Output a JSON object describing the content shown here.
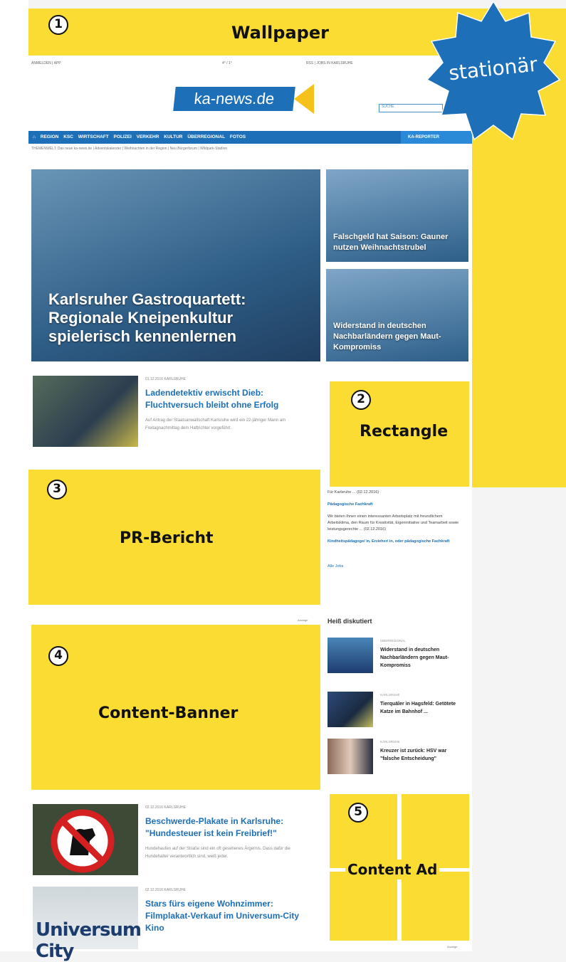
{
  "zones": {
    "wallpaper": {
      "number": "1",
      "label": "Wallpaper"
    },
    "rectangle": {
      "number": "2",
      "label": "Rectangle"
    },
    "pr_bericht": {
      "number": "3",
      "label": "PR-Bericht"
    },
    "content_banner": {
      "number": "4",
      "label": "Content-Banner"
    },
    "content_ad": {
      "number": "5",
      "label": "Content Ad"
    }
  },
  "stamp": {
    "label": "stationär",
    "color": "#1d6fb8"
  },
  "colors": {
    "accent_yellow": "#fadc32",
    "brand_blue": "#1d6fb8"
  },
  "site": {
    "logo": "ka-news.de",
    "topbar_left": "ANMELDEN  |  APP",
    "topbar_weather": "4° / 1°",
    "topbar_right": "RSS  |  JOBS IN KARLSRUHE",
    "search_placeholder": "SUCHE"
  },
  "nav": {
    "items": [
      "REGION",
      "KSC",
      "WIRTSCHAFT",
      "POLIZEI",
      "VERKEHR",
      "KULTUR",
      "ÜBERREGIONAL",
      "FOTOS"
    ],
    "reporter": "KA-REPORTER"
  },
  "themes": "THEMENWELT: Das neue ka-news.de  |  Adventskalender  |  Weihnachten in der Region  |  Neu Bürgerforum  |  Wildpark-Stadion",
  "hero": {
    "title": "Karlsruher Gastroquartett: Regionale Kneipenkultur spielerisch kennenlernen"
  },
  "side_teasers": [
    {
      "title": "Falschgeld hat Saison: Gauner nutzen Weihnachtstrubel"
    },
    {
      "title": "Widerstand in deutschen Nachbarländern gegen Maut-Kompromiss"
    }
  ],
  "articles": [
    {
      "meta": "01.12.2016   KARLSRUHE",
      "title": "Ladendetektiv erwischt Dieb: Fluchtversuch bleibt ohne Erfolg",
      "text": "Auf Antrag der Staatsanwaltschaft Karlsruhe wird ein 22-jähriger Mann am Freitagnachmittag dem Haftrichter vorgeführt."
    },
    {
      "meta": "02.12.2016   KARLSRUHE",
      "title": "Beschwerde-Plakate in Karlsruhe: \"Hundesteuer ist kein Freibrief!\"",
      "text": "Hundehaufen auf der Straße sind ein oft gesehenes Ärgernis. Dass dafür die Hundehalter verantwortlich sind, weiß jeder."
    },
    {
      "meta": "02.12.2016   KARLSRUHE",
      "title": "Stars fürs eigene Wohnzimmer: Filmplakat-Verkauf im Universum-City Kino",
      "text": ""
    }
  ],
  "jobs": {
    "line1": "Für Karlsruhe ... (02.12.2016)",
    "link1": "Pädagogische Fachkraft",
    "text": "Wir bieten Ihnen einen interessanten Arbeitsplatz mit freundlichem Arbeitsklima, den Raum für Kreativität, Eigeninitiative und Teamarbeit sowie leistungsgerechte ... (02.12.2016)",
    "link2": "Kindheitspädagoge/ in, Erzieher/ in, oder pädagogische Fachkraft",
    "all": "Alle Jobs"
  },
  "hot": {
    "heading": "Heiß diskutiert",
    "items": [
      {
        "meta": "ÜBERREGIONAL",
        "title": "Widerstand in deutschen Nachbarländern gegen Maut-Kompromiss"
      },
      {
        "meta": "KARLSRUHE",
        "title": "Tierquäler in Hagsfeld: Getötete Katze im Bahnhof ..."
      },
      {
        "meta": "KARLSRUHE",
        "title": "Kreuzer ist zurück: HSV war \"falsche Entscheidung\""
      }
    ]
  },
  "anzeige": "Anzeige"
}
